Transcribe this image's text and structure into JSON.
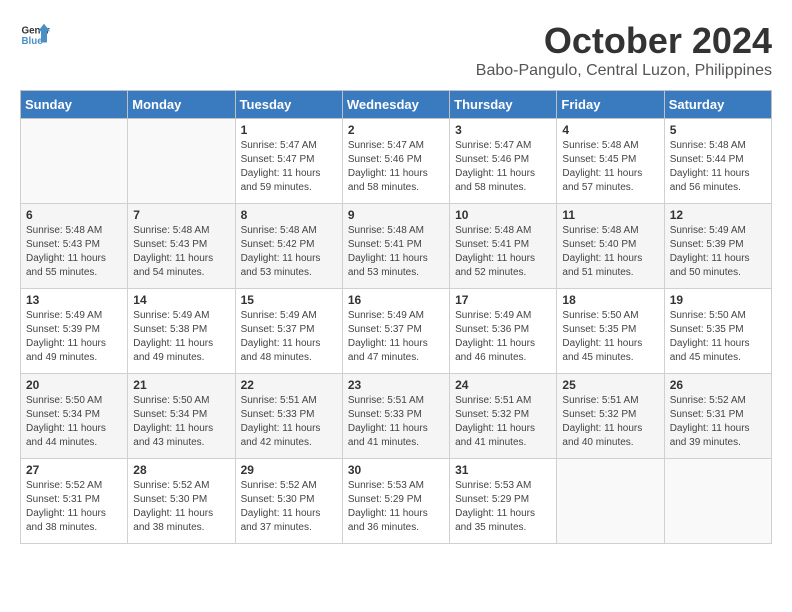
{
  "header": {
    "logo_general": "General",
    "logo_blue": "Blue",
    "month_title": "October 2024",
    "location": "Babo-Pangulo, Central Luzon, Philippines"
  },
  "days_of_week": [
    "Sunday",
    "Monday",
    "Tuesday",
    "Wednesday",
    "Thursday",
    "Friday",
    "Saturday"
  ],
  "weeks": [
    [
      {
        "day": "",
        "info": ""
      },
      {
        "day": "",
        "info": ""
      },
      {
        "day": "1",
        "info": "Sunrise: 5:47 AM\nSunset: 5:47 PM\nDaylight: 11 hours and 59 minutes."
      },
      {
        "day": "2",
        "info": "Sunrise: 5:47 AM\nSunset: 5:46 PM\nDaylight: 11 hours and 58 minutes."
      },
      {
        "day": "3",
        "info": "Sunrise: 5:47 AM\nSunset: 5:46 PM\nDaylight: 11 hours and 58 minutes."
      },
      {
        "day": "4",
        "info": "Sunrise: 5:48 AM\nSunset: 5:45 PM\nDaylight: 11 hours and 57 minutes."
      },
      {
        "day": "5",
        "info": "Sunrise: 5:48 AM\nSunset: 5:44 PM\nDaylight: 11 hours and 56 minutes."
      }
    ],
    [
      {
        "day": "6",
        "info": "Sunrise: 5:48 AM\nSunset: 5:43 PM\nDaylight: 11 hours and 55 minutes."
      },
      {
        "day": "7",
        "info": "Sunrise: 5:48 AM\nSunset: 5:43 PM\nDaylight: 11 hours and 54 minutes."
      },
      {
        "day": "8",
        "info": "Sunrise: 5:48 AM\nSunset: 5:42 PM\nDaylight: 11 hours and 53 minutes."
      },
      {
        "day": "9",
        "info": "Sunrise: 5:48 AM\nSunset: 5:41 PM\nDaylight: 11 hours and 53 minutes."
      },
      {
        "day": "10",
        "info": "Sunrise: 5:48 AM\nSunset: 5:41 PM\nDaylight: 11 hours and 52 minutes."
      },
      {
        "day": "11",
        "info": "Sunrise: 5:48 AM\nSunset: 5:40 PM\nDaylight: 11 hours and 51 minutes."
      },
      {
        "day": "12",
        "info": "Sunrise: 5:49 AM\nSunset: 5:39 PM\nDaylight: 11 hours and 50 minutes."
      }
    ],
    [
      {
        "day": "13",
        "info": "Sunrise: 5:49 AM\nSunset: 5:39 PM\nDaylight: 11 hours and 49 minutes."
      },
      {
        "day": "14",
        "info": "Sunrise: 5:49 AM\nSunset: 5:38 PM\nDaylight: 11 hours and 49 minutes."
      },
      {
        "day": "15",
        "info": "Sunrise: 5:49 AM\nSunset: 5:37 PM\nDaylight: 11 hours and 48 minutes."
      },
      {
        "day": "16",
        "info": "Sunrise: 5:49 AM\nSunset: 5:37 PM\nDaylight: 11 hours and 47 minutes."
      },
      {
        "day": "17",
        "info": "Sunrise: 5:49 AM\nSunset: 5:36 PM\nDaylight: 11 hours and 46 minutes."
      },
      {
        "day": "18",
        "info": "Sunrise: 5:50 AM\nSunset: 5:35 PM\nDaylight: 11 hours and 45 minutes."
      },
      {
        "day": "19",
        "info": "Sunrise: 5:50 AM\nSunset: 5:35 PM\nDaylight: 11 hours and 45 minutes."
      }
    ],
    [
      {
        "day": "20",
        "info": "Sunrise: 5:50 AM\nSunset: 5:34 PM\nDaylight: 11 hours and 44 minutes."
      },
      {
        "day": "21",
        "info": "Sunrise: 5:50 AM\nSunset: 5:34 PM\nDaylight: 11 hours and 43 minutes."
      },
      {
        "day": "22",
        "info": "Sunrise: 5:51 AM\nSunset: 5:33 PM\nDaylight: 11 hours and 42 minutes."
      },
      {
        "day": "23",
        "info": "Sunrise: 5:51 AM\nSunset: 5:33 PM\nDaylight: 11 hours and 41 minutes."
      },
      {
        "day": "24",
        "info": "Sunrise: 5:51 AM\nSunset: 5:32 PM\nDaylight: 11 hours and 41 minutes."
      },
      {
        "day": "25",
        "info": "Sunrise: 5:51 AM\nSunset: 5:32 PM\nDaylight: 11 hours and 40 minutes."
      },
      {
        "day": "26",
        "info": "Sunrise: 5:52 AM\nSunset: 5:31 PM\nDaylight: 11 hours and 39 minutes."
      }
    ],
    [
      {
        "day": "27",
        "info": "Sunrise: 5:52 AM\nSunset: 5:31 PM\nDaylight: 11 hours and 38 minutes."
      },
      {
        "day": "28",
        "info": "Sunrise: 5:52 AM\nSunset: 5:30 PM\nDaylight: 11 hours and 38 minutes."
      },
      {
        "day": "29",
        "info": "Sunrise: 5:52 AM\nSunset: 5:30 PM\nDaylight: 11 hours and 37 minutes."
      },
      {
        "day": "30",
        "info": "Sunrise: 5:53 AM\nSunset: 5:29 PM\nDaylight: 11 hours and 36 minutes."
      },
      {
        "day": "31",
        "info": "Sunrise: 5:53 AM\nSunset: 5:29 PM\nDaylight: 11 hours and 35 minutes."
      },
      {
        "day": "",
        "info": ""
      },
      {
        "day": "",
        "info": ""
      }
    ]
  ]
}
